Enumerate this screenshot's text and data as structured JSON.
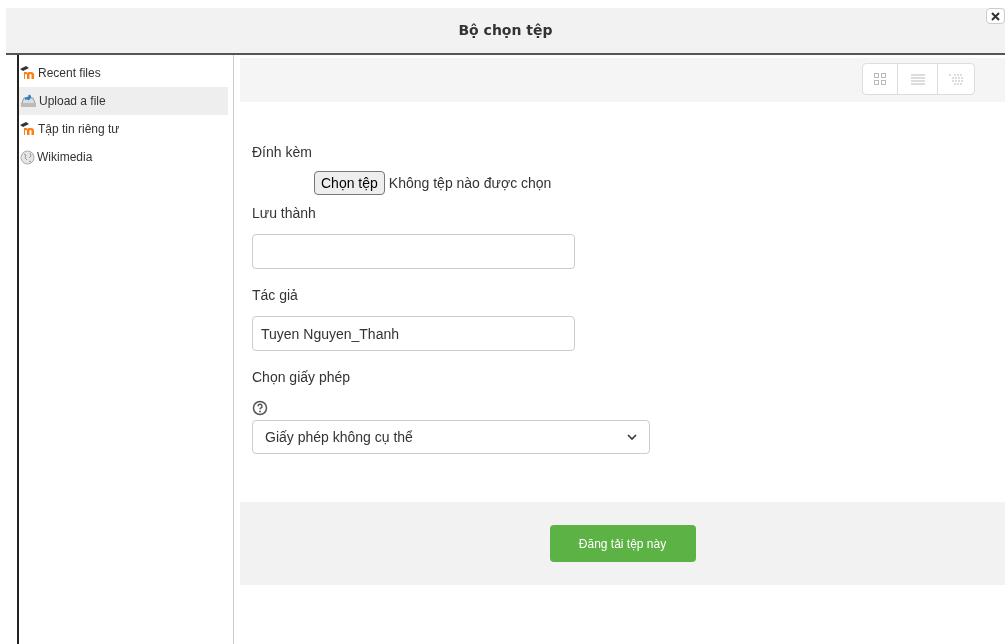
{
  "dialog": {
    "title": "Bộ chọn tệp"
  },
  "sidebar": {
    "items": [
      {
        "label": "Recent files",
        "kind": "moodle",
        "selected": false
      },
      {
        "label": "Upload a file",
        "kind": "upload",
        "selected": true
      },
      {
        "label": "Tập tin riêng tư",
        "kind": "moodle",
        "selected": false
      },
      {
        "label": "Wikimedia",
        "kind": "wikimedia",
        "selected": false
      }
    ]
  },
  "form": {
    "attachment": {
      "label": "Đính kèm",
      "button": "Chọn tệp",
      "status": "Không tệp nào được chọn"
    },
    "save_as": {
      "label": "Lưu thành"
    },
    "author": {
      "label": "Tác giả",
      "value": "Tuyen Nguyen_Thanh"
    },
    "license": {
      "label": "Chọn giấy phép",
      "value": "Giấy phép không cụ thể"
    }
  },
  "submit_button": "Đăng tải tệp này"
}
